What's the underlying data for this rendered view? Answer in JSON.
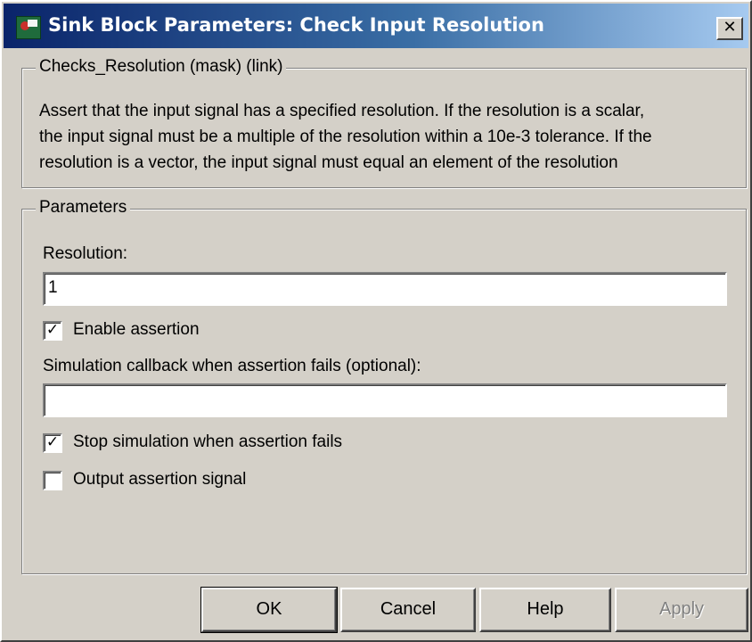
{
  "window": {
    "title": "Sink Block Parameters: Check Input  Resolution",
    "close_glyph": "✕"
  },
  "mask_group": {
    "legend": "Checks_Resolution (mask) (link)",
    "description_lines": [
      "Assert that the input signal has a specified resolution.  If the resolution is a scalar,",
      "the input signal must be a multiple of the resolution within a 10e-3 tolerance.  If the",
      "resolution is a vector, the input signal must equal an element of the resolution"
    ]
  },
  "parameters": {
    "legend": "Parameters",
    "resolution_label": "Resolution:",
    "resolution_value": "1",
    "enable_assertion": {
      "label": "Enable assertion",
      "checked": true
    },
    "callback_label": "Simulation callback when assertion fails (optional):",
    "callback_value": "",
    "stop_simulation": {
      "label": "Stop simulation when assertion fails",
      "checked": true
    },
    "output_signal": {
      "label": "Output assertion signal",
      "checked": false
    }
  },
  "buttons": {
    "ok": "OK",
    "cancel": "Cancel",
    "help": "Help",
    "apply": "Apply"
  },
  "icons": {
    "title_icon": "simulink-block-icon",
    "close_icon": "close-icon",
    "check_icon": "checkmark-icon"
  }
}
